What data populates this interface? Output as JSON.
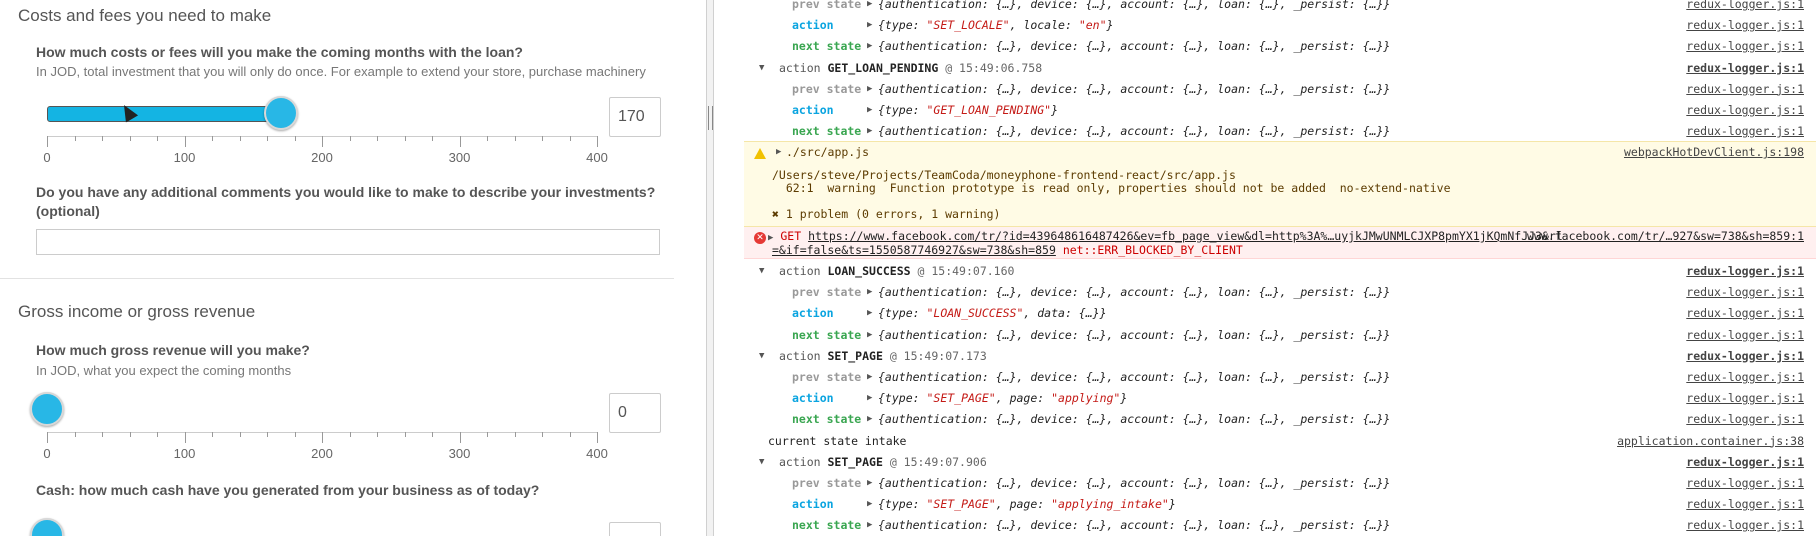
{
  "form": {
    "costs": {
      "title": "Costs and fees you need to make",
      "question": "How much costs or fees will you make the coming months with the loan?",
      "hint": "In JOD, total investment that you will only do once. For example to extend your store, purchase machinery",
      "value": "170",
      "slider_value": 170
    },
    "comments": {
      "question_line1": "Do you have any additional comments you would like to make to describe your investments?",
      "question_line2": "(optional)",
      "value": ""
    },
    "revenue": {
      "title": "Gross income or gross revenue",
      "question": "How much gross revenue will you make?",
      "hint": "In JOD, what you expect the coming months",
      "value": "0",
      "slider_value": 0
    },
    "cash": {
      "question": "Cash: how much cash have you generated from your business as of today?"
    },
    "scale": {
      "min": 0,
      "max": 400,
      "labels": [
        "0",
        "100",
        "200",
        "300",
        "400"
      ]
    }
  },
  "console": {
    "rows": [
      {
        "type": "state",
        "key": "prev state",
        "val": "{authentication: {…}, device: {…}, account: {…}, loan: {…}, _persist: {…}}",
        "src": "redux-logger.js:1"
      },
      {
        "type": "action",
        "key": "action",
        "pre": "{type: ",
        "s1": "\"SET_LOCALE\"",
        "mid": ", locale: ",
        "s2": "\"en\"",
        "post": "}",
        "src": "redux-logger.js:1"
      },
      {
        "type": "next",
        "key": "next state",
        "val": "{authentication: {…}, device: {…}, account: {…}, loan: {…}, _persist: {…}}",
        "src": "redux-logger.js:1"
      },
      {
        "type": "group",
        "label": "action",
        "name": "GET_LOAN_PENDING",
        "time": "@ 15:49:06.758",
        "src": "redux-logger.js:1"
      },
      {
        "type": "state",
        "key": "prev state",
        "val": "{authentication: {…}, device: {…}, account: {…}, loan: {…}, _persist: {…}}",
        "src": "redux-logger.js:1"
      },
      {
        "type": "action",
        "key": "action",
        "pre": "{type: ",
        "s1": "\"GET_LOAN_PENDING\"",
        "mid": "",
        "s2": "",
        "post": "}",
        "src": "redux-logger.js:1"
      },
      {
        "type": "next",
        "key": "next state",
        "val": "{authentication: {…}, device: {…}, account: {…}, loan: {…}, _persist: {…}}",
        "src": "redux-logger.js:1"
      }
    ],
    "warning": {
      "title": "./src/app.js",
      "src": "webpackHotDevClient.js:198",
      "line1": "/Users/steve/Projects/TeamCoda/moneyphone-frontend-react/src/app.js",
      "line2": "  62:1  warning  Function prototype is read only, properties should not be added  no-extend-native",
      "line3": "✖ 1 problem (0 errors, 1 warning)"
    },
    "error": {
      "method": "GET",
      "url": "https://www.facebook.com/tr/?id=439648616487426&ev=fb_page_view&dl=http%3A%…uyjkJMwUNMLCJXP8pmYX1jKQmNfJJ3&rl",
      "url2": "=&if=false&ts=1550587746927&sw=738&sh=859",
      "err": "net::ERR_BLOCKED_BY_CLIENT",
      "src": "www.facebook.com/tr/…927&sw=738&sh=859:1"
    },
    "rows2": [
      {
        "type": "group",
        "label": "action",
        "name": "LOAN_SUCCESS",
        "time": "@ 15:49:07.160",
        "src": "redux-logger.js:1"
      },
      {
        "type": "state",
        "key": "prev state",
        "val": "{authentication: {…}, device: {…}, account: {…}, loan: {…}, _persist: {…}}",
        "src": "redux-logger.js:1"
      },
      {
        "type": "action",
        "key": "action",
        "pre": "{type: ",
        "s1": "\"LOAN_SUCCESS\"",
        "mid": ", data: {…}",
        "s2": "",
        "post": "}",
        "src": "redux-logger.js:1"
      },
      {
        "type": "next",
        "key": "next state",
        "val": "{authentication: {…}, device: {…}, account: {…}, loan: {…}, _persist: {…}}",
        "src": "redux-logger.js:1"
      },
      {
        "type": "group",
        "label": "action",
        "name": "SET_PAGE",
        "time": "@ 15:49:07.173",
        "src": "redux-logger.js:1"
      },
      {
        "type": "state",
        "key": "prev state",
        "val": "{authentication: {…}, device: {…}, account: {…}, loan: {…}, _persist: {…}}",
        "src": "redux-logger.js:1"
      },
      {
        "type": "action",
        "key": "action",
        "pre": "{type: ",
        "s1": "\"SET_PAGE\"",
        "mid": ", page: ",
        "s2": "\"applying\"",
        "post": "}",
        "src": "redux-logger.js:1"
      },
      {
        "type": "next",
        "key": "next state",
        "val": "{authentication: {…}, device: {…}, account: {…}, loan: {…}, _persist: {…}}",
        "src": "redux-logger.js:1"
      },
      {
        "type": "log",
        "text": "current state intake",
        "src": "application.container.js:38"
      },
      {
        "type": "group",
        "label": "action",
        "name": "SET_PAGE",
        "time": "@ 15:49:07.906",
        "src": "redux-logger.js:1"
      },
      {
        "type": "state",
        "key": "prev state",
        "val": "{authentication: {…}, device: {…}, account: {…}, loan: {…}, _persist: {…}}",
        "src": "redux-logger.js:1"
      },
      {
        "type": "action",
        "key": "action",
        "pre": "{type: ",
        "s1": "\"SET_PAGE\"",
        "mid": ", page: ",
        "s2": "\"applying_intake\"",
        "post": "}",
        "src": "redux-logger.js:1"
      },
      {
        "type": "next",
        "key": "next state",
        "val": "{authentication: {…}, device: {…}, account: {…}, loan: {…}, _persist: {…}}",
        "src": "redux-logger.js:1"
      }
    ]
  }
}
